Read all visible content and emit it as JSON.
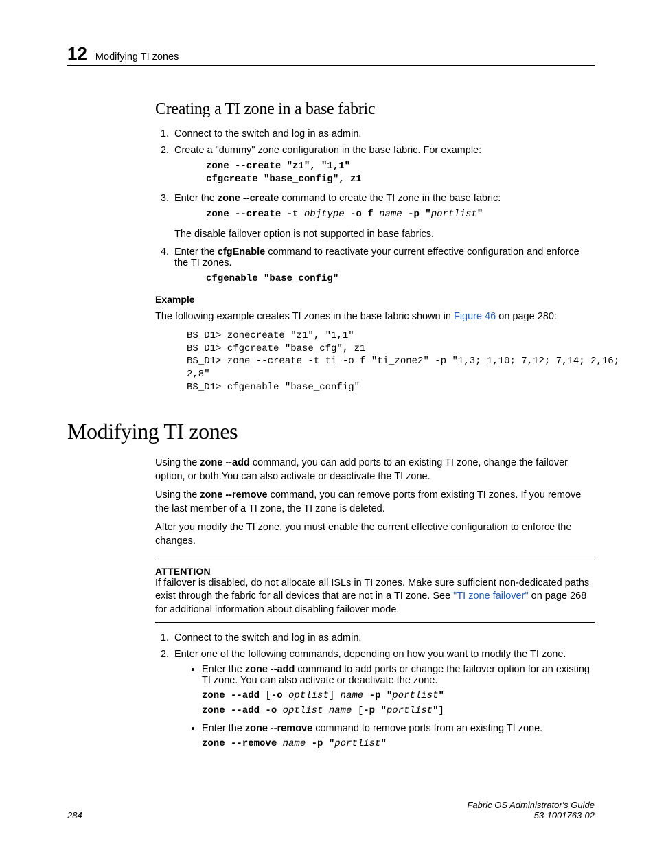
{
  "header": {
    "chapnum": "12",
    "chaptitle": "Modifying TI zones"
  },
  "sec1": {
    "title": "Creating a TI zone in a base fabric",
    "step1": "Connect to the switch and log in as admin.",
    "step2": "Create a \"dummy\" zone configuration in the base fabric. For example:",
    "code2": "zone --create \"z1\", \"1,1\"\ncfgcreate \"base_config\", z1",
    "step3_pre": "Enter the ",
    "step3_cmd": "zone --create",
    "step3_post": " command to create the TI zone in the base fabric:",
    "code3_a": "zone --create -t ",
    "code3_b": "objtype",
    "code3_c": " -o f ",
    "code3_d": "name",
    "code3_e": " -p \"",
    "code3_f": "portlist",
    "code3_g": "\"",
    "step3_note": "The disable failover option is not supported in base fabrics.",
    "step4_pre": "Enter the ",
    "step4_cmd": "cfgEnable",
    "step4_post": " command to reactivate your current effective configuration and enforce the TI zones.",
    "code4": "cfgenable \"base_config\"",
    "example_label": "Example",
    "example_intro_pre": "The following example creates TI zones in the base fabric shown in ",
    "example_intro_link": "Figure 46",
    "example_intro_post": " on page 280:",
    "example_output": "BS_D1> zonecreate \"z1\", \"1,1\"\nBS_D1> cfgcreate \"base_cfg\", z1\nBS_D1> zone --create -t ti -o f \"ti_zone2\" -p \"1,3; 1,10; 7,12; 7,14; 2,16; \n2,8\"\nBS_D1> cfgenable \"base_config\""
  },
  "sec2": {
    "title": "Modifying TI zones",
    "p1_a": "Using the ",
    "p1_cmd1": "zone --add",
    "p1_b": " command, you can add ports to an existing TI zone, change the failover option, or both.You can also activate or deactivate the TI zone.",
    "p2_a": "Using the ",
    "p2_cmd1": "zone --remove",
    "p2_b": " command, you can remove ports from existing TI zones. If you remove the last member of a TI zone, the TI zone is deleted.",
    "p3": "After you modify the TI zone, you must enable the current effective configuration to enforce the changes.",
    "attention_label": "ATTENTION",
    "attention_body_a": "If failover is disabled, do not allocate all ISLs in TI zones. Make sure sufficient non-dedicated paths exist through the fabric for all devices that are not in a TI zone. See ",
    "attention_link": "\"TI zone failover\"",
    "attention_body_b": " on page 268 for additional information about disabling failover mode.",
    "step1": "Connect to the switch and log in as admin.",
    "step2": "Enter one of the following commands, depending on how you want to modify the TI zone.",
    "bullet1_a": "Enter the ",
    "bullet1_cmd": "zone --add",
    "bullet1_b": " command to add ports or change the failover option for an existing TI zone. You can also activate or deactivate the zone.",
    "b1_code1_a": "zone --add ",
    "b1_code1_b": "[",
    "b1_code1_c": "-o ",
    "b1_code1_d": "optlist",
    "b1_code1_e": "] ",
    "b1_code1_f": "name",
    "b1_code1_g": " -p \"",
    "b1_code1_h": "portlist",
    "b1_code1_i": "\"",
    "b1_code2_a": "zone --add -o ",
    "b1_code2_b": "optlist name",
    "b1_code2_c": " [",
    "b1_code2_d": "-p \"",
    "b1_code2_e": "portlist",
    "b1_code2_f": "\"",
    "b1_code2_g": "]",
    "bullet2_a": "Enter the ",
    "bullet2_cmd": "zone --remove",
    "bullet2_b": " command to remove ports from an existing TI zone.",
    "b2_code_a": "zone --remove ",
    "b2_code_b": "name",
    "b2_code_c": " -p \"",
    "b2_code_d": "portlist",
    "b2_code_e": "\""
  },
  "footer": {
    "pagenum": "284",
    "booktitle": "Fabric OS Administrator's Guide",
    "docnum": "53-1001763-02"
  }
}
